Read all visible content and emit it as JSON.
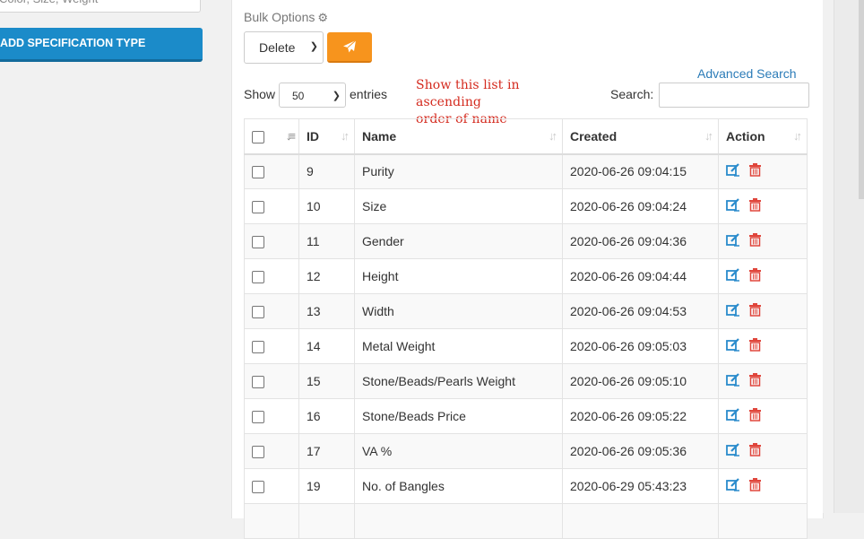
{
  "sidebar": {
    "spec_input_value": "Color, Size, Weight",
    "add_button_label": "ADD SPECIFICATION TYPE"
  },
  "toolbar": {
    "bulk_options_label": "Bulk Options",
    "bulk_action_selected": "Delete",
    "apply_icon": "paper-plane-icon"
  },
  "list_controls": {
    "advanced_search_label": "Advanced Search",
    "show_label": "Show",
    "page_length": "50",
    "entries_label": "entries",
    "search_label": "Search:",
    "search_value": ""
  },
  "annotation": {
    "line1": "Show this list in ascending",
    "line2": "order of name"
  },
  "table": {
    "columns": [
      "ID",
      "Name",
      "Created",
      "Action"
    ],
    "rows": [
      {
        "id": "9",
        "name": "Purity",
        "created": "2020-06-26 09:04:15"
      },
      {
        "id": "10",
        "name": "Size",
        "created": "2020-06-26 09:04:24"
      },
      {
        "id": "11",
        "name": "Gender",
        "created": "2020-06-26 09:04:36"
      },
      {
        "id": "12",
        "name": "Height",
        "created": "2020-06-26 09:04:44"
      },
      {
        "id": "13",
        "name": "Width",
        "created": "2020-06-26 09:04:53"
      },
      {
        "id": "14",
        "name": "Metal Weight",
        "created": "2020-06-26 09:05:03"
      },
      {
        "id": "15",
        "name": "Stone/Beads/Pearls Weight",
        "created": "2020-06-26 09:05:10"
      },
      {
        "id": "16",
        "name": "Stone/Beads Price",
        "created": "2020-06-26 09:05:22"
      },
      {
        "id": "17",
        "name": "VA %",
        "created": "2020-06-26 09:05:36"
      },
      {
        "id": "19",
        "name": "No. of Bangles",
        "created": "2020-06-29 05:43:23"
      },
      {
        "id": "",
        "name": "",
        "created": ""
      }
    ]
  },
  "colors": {
    "primary_button": "#1b8bc9",
    "apply_button": "#f7941d",
    "edit_icon": "#2a8bcc",
    "delete_icon": "#e0463c",
    "annotation": "#d42a1e",
    "link": "#2c7cb8"
  }
}
